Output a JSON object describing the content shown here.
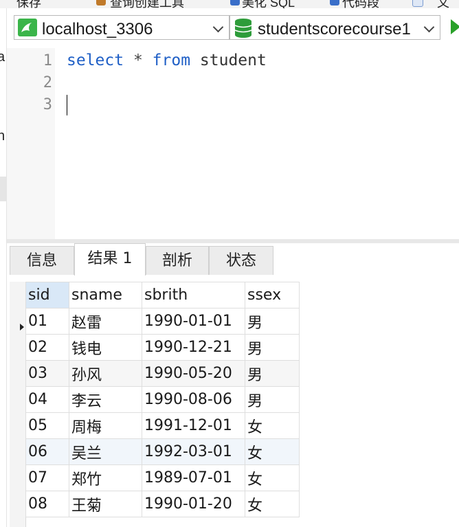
{
  "toolbar": {
    "items": [
      "保存",
      "查询创建工具",
      "美化 SQL",
      "代码段",
      "文"
    ]
  },
  "connection": {
    "server": "localhost_3306",
    "database": "studentscorecourse1"
  },
  "editor": {
    "line_numbers": [
      "1",
      "2",
      "3"
    ],
    "code": {
      "kw1": "select",
      "star": "*",
      "kw2": "from",
      "table": "student"
    }
  },
  "tabs": {
    "info": "信息",
    "result": "结果 1",
    "profile": "剖析",
    "status": "状态",
    "active": "result"
  },
  "grid": {
    "columns": [
      "sid",
      "sname",
      "sbrith",
      "ssex"
    ],
    "rows": [
      [
        "01",
        "赵雷",
        "1990-01-01",
        "男"
      ],
      [
        "02",
        "钱电",
        "1990-12-21",
        "男"
      ],
      [
        "03",
        "孙风",
        "1990-05-20",
        "男"
      ],
      [
        "04",
        "李云",
        "1990-08-06",
        "男"
      ],
      [
        "05",
        "周梅",
        "1991-12-01",
        "女"
      ],
      [
        "06",
        "吴兰",
        "1992-03-01",
        "女"
      ],
      [
        "07",
        "郑竹",
        "1989-07-01",
        "女"
      ],
      [
        "08",
        "王菊",
        "1990-01-20",
        "女"
      ]
    ]
  },
  "colors": {
    "keyword": "#1f5fc6",
    "connection_icon": "#3bb54a",
    "database_icon": "#2e9c3a",
    "run_button": "#2aa12a",
    "selected_header": "#d9e8f7"
  },
  "icons": {
    "connection": "mysql-connection-icon",
    "database": "database-icon",
    "run": "run-icon",
    "dropdown": "chevron-down-icon"
  }
}
